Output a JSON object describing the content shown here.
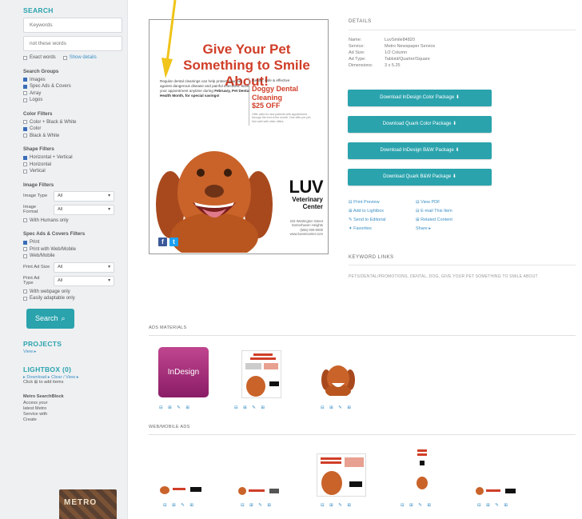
{
  "search": {
    "title": "SEARCH",
    "keywords_placeholder": "Keywords",
    "not_words_placeholder": "not these words",
    "exact_label": "Exact words",
    "show_details": "Show details"
  },
  "search_groups": {
    "title": "Search Groups",
    "items": [
      {
        "label": "Images",
        "checked": true
      },
      {
        "label": "Spec Ads & Covers",
        "checked": true
      },
      {
        "label": "Array",
        "checked": false
      },
      {
        "label": "Logos",
        "checked": false
      }
    ]
  },
  "color_filters": {
    "title": "Color Filters",
    "items": [
      {
        "label": "Color + Black & White",
        "checked": false
      },
      {
        "label": "Color",
        "checked": true
      },
      {
        "label": "Black & White",
        "checked": false
      }
    ]
  },
  "shape_filters": {
    "title": "Shape Filters",
    "items": [
      {
        "label": "Horizontal + Vertical",
        "checked": true
      },
      {
        "label": "Horizontal",
        "checked": false
      },
      {
        "label": "Vertical",
        "checked": false
      }
    ]
  },
  "image_filters": {
    "title": "Image Filters",
    "type_label": "Image Type",
    "type_value": "All",
    "format_label": "Image Format",
    "format_value": "All",
    "with_people": "With Humans only"
  },
  "spec_filters": {
    "title": "Spec Ads & Covers Filters",
    "items": [
      {
        "label": "Print",
        "checked": true
      },
      {
        "label": "Print with Web/Mobile",
        "checked": false
      },
      {
        "label": "Web/Mobile",
        "checked": false
      }
    ],
    "size_label": "Print Ad Size",
    "size_value": "All",
    "ptype_label": "Print Ad Type",
    "ptype_value": "All",
    "extra1": "With webpage only",
    "extra2": "Easily adaptable only"
  },
  "search_button": "Search",
  "projects": {
    "title": "PROJECTS",
    "link": "View ▸"
  },
  "lightbox": {
    "title": "LIGHTBOX (0)",
    "links": "▸ Download  ▸ Clear / View ▸",
    "hint": "Click ⊞ to add items"
  },
  "blog": {
    "title": "Metro SearchBlock",
    "text": "Access your latest Metro Service with Create",
    "thumb_text": "METRO"
  },
  "ad": {
    "headline1": "Give Your Pet",
    "headline2": "Something to Smile",
    "headline3": "About!",
    "body": "Regular dental cleanings can help protect your pet against dangerous disease and painful infections. Book your appointment anytime during",
    "body_bold": "February, Pet Dental Health Month, for special savings!",
    "right_intro": "Gentle, safe & effective",
    "offer1": "Doggy Dental",
    "offer2": "Cleaning",
    "offer3": "$25 OFF",
    "fine": "Offer valid for new patients with appointment through the end of the month. One offer per pet. Not valid with other offers.",
    "brand": "LUV",
    "brand_sub1": "Veterinary",
    "brand_sub2": "Center",
    "addr1": "234 Westington Street",
    "addr2": "Somerhaven Heights",
    "addr3": "(555) 000-0000",
    "addr4": "www.luvvetcenter.com",
    "fb": "f",
    "tw": "t"
  },
  "details": {
    "title": "DETAILS",
    "rows": [
      {
        "k": "Name:",
        "v": "LuvSmile84820"
      },
      {
        "k": "Service:",
        "v": "Metro Newspaper Service"
      },
      {
        "k": "Ad Size:",
        "v": "1/2 Column"
      },
      {
        "k": "Ad Type:",
        "v": "Tabloid/Quarter/Square"
      },
      {
        "k": "Dimensions:",
        "v": "3 x 5.25"
      }
    ]
  },
  "downloads": [
    "Download InDesign Color Package",
    "Download Quark Color Package",
    "Download InDesign B&W Package",
    "Download Quark B&W Package"
  ],
  "actions": [
    [
      "⊟ Print Preview",
      "⊟ View PDF"
    ],
    [
      "⊞ Add to Lightbox",
      "⊟ E-mail This Item"
    ],
    [
      "✎ Send to Editorial",
      "⊞ Related Content"
    ],
    [
      "✦ Favorites",
      "Share ▸"
    ]
  ],
  "keyword_links": {
    "title": "KEYWORD LINKS",
    "text": "PETS/DENTAL/PROMOTIONS, DENTAL, DOG, GIVE YOUR PET SOMETHING TO SMILE ABOUT"
  },
  "materials": {
    "ad_title": "ADS MATERIALS",
    "web_title": "WEB/MOBILE ADS",
    "indesign_label": "InDesign",
    "row_icons": "⊟ ⊞ ✎ ⊞"
  },
  "colors": {
    "accent": "#2aa3ad",
    "headline": "#d03e28",
    "link": "#3a8fc4"
  }
}
